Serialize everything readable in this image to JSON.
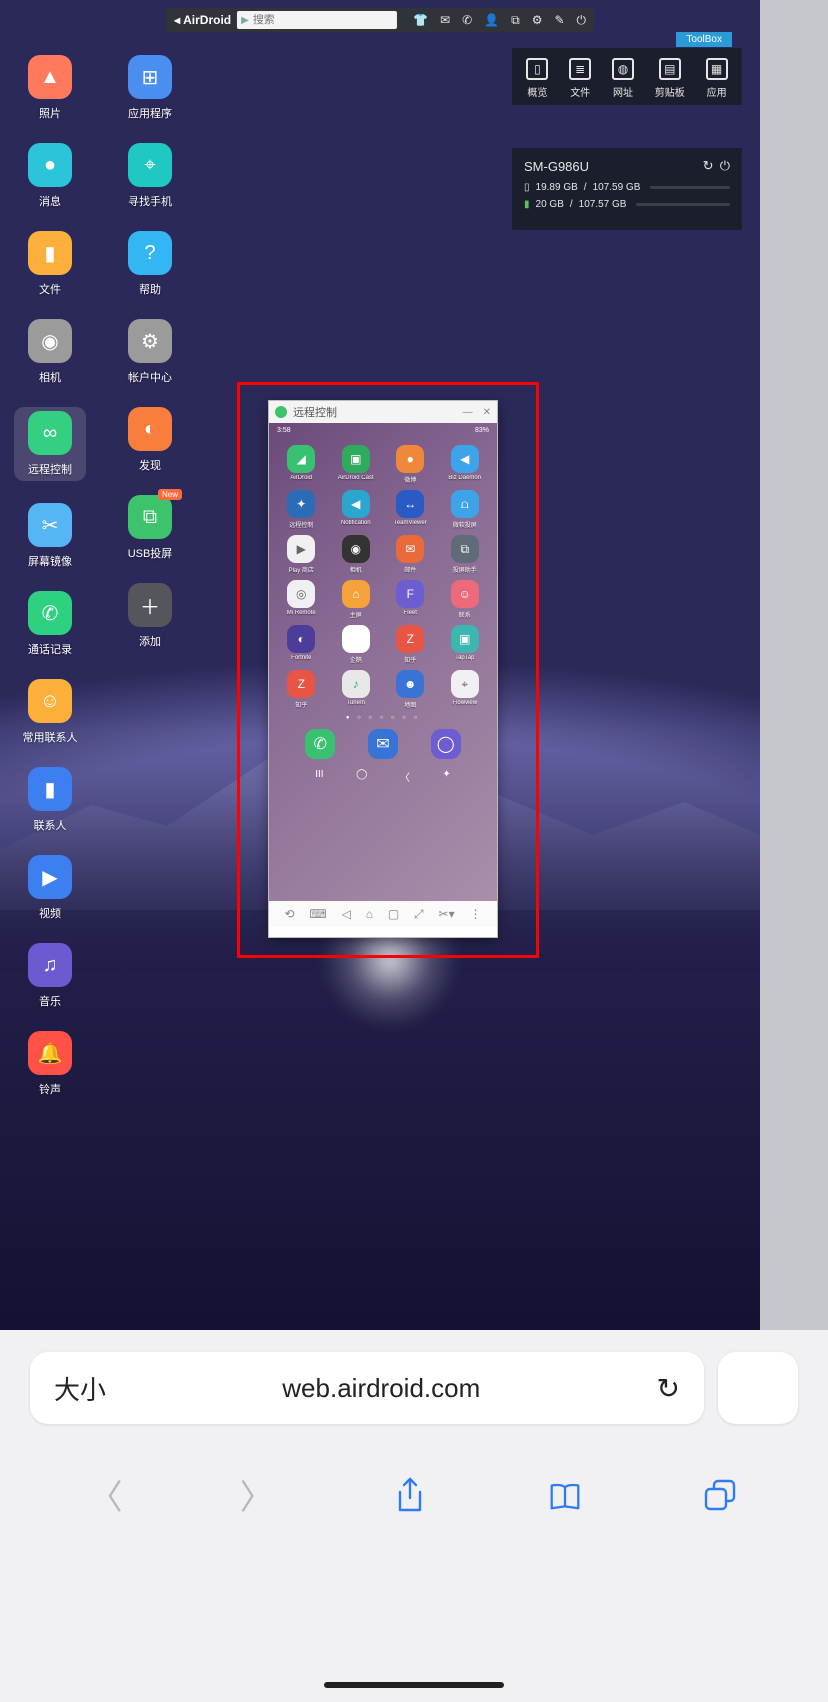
{
  "topbar": {
    "brand": "AirDroid",
    "search_placeholder": "搜索"
  },
  "desktop_icons": {
    "col1": [
      {
        "label": "照片",
        "cls": "c-red",
        "glyph": "▲"
      },
      {
        "label": "消息",
        "cls": "c-teal",
        "glyph": "●"
      },
      {
        "label": "文件",
        "cls": "c-orange",
        "glyph": "▮"
      },
      {
        "label": "相机",
        "cls": "c-gray",
        "glyph": "◉"
      },
      {
        "label": "远程控制",
        "cls": "c-green",
        "glyph": "∞",
        "sel": true
      },
      {
        "label": "屏幕镜像",
        "cls": "c-lblue",
        "glyph": "✂"
      },
      {
        "label": "通话记录",
        "cls": "c-tealg",
        "glyph": "✆"
      },
      {
        "label": "常用联系人",
        "cls": "c-orange",
        "glyph": "☺"
      },
      {
        "label": "联系人",
        "cls": "c-navy",
        "glyph": "▮"
      },
      {
        "label": "视频",
        "cls": "c-navy",
        "glyph": "▶"
      },
      {
        "label": "音乐",
        "cls": "c-purple",
        "glyph": "♫"
      },
      {
        "label": "铃声",
        "cls": "c-red2",
        "glyph": "🔔"
      }
    ],
    "col2": [
      {
        "label": "应用程序",
        "cls": "c-blue",
        "glyph": "⊞"
      },
      {
        "label": "寻找手机",
        "cls": "c-teal2",
        "glyph": "⌖"
      },
      {
        "label": "帮助",
        "cls": "c-cyan",
        "glyph": "?"
      },
      {
        "label": "帐户中心",
        "cls": "c-gray",
        "glyph": "⚙"
      },
      {
        "label": "发现",
        "cls": "c-orange2",
        "glyph": "◐"
      },
      {
        "label": "USB投屏",
        "cls": "c-green2",
        "glyph": "⧉",
        "new": true
      },
      {
        "label": "添加",
        "cls": "c-dark",
        "glyph": "＋"
      }
    ]
  },
  "toolbox": {
    "tab": "ToolBox",
    "items": [
      {
        "label": "概览",
        "glyph": "▯"
      },
      {
        "label": "文件",
        "glyph": "≣"
      },
      {
        "label": "网址",
        "glyph": "◍"
      },
      {
        "label": "剪贴板",
        "glyph": "▤"
      },
      {
        "label": "应用",
        "glyph": "▦"
      }
    ]
  },
  "device": {
    "name": "SM-G986U",
    "storage_used": "19.89 GB",
    "storage_total": "107.59 GB",
    "sd_used": "20 GB",
    "sd_total": "107.57 GB",
    "sep": " / "
  },
  "remote": {
    "title": "远程控制",
    "status_time": "3:58",
    "status_right": "83%",
    "apps": [
      {
        "l": "AirDroid",
        "c": "p-green",
        "g": "◢"
      },
      {
        "l": "AirDroid Cast",
        "c": "p-grn2",
        "g": "▣"
      },
      {
        "l": "微博",
        "c": "p-orange",
        "g": "●"
      },
      {
        "l": "Biz Daemon",
        "c": "p-blue",
        "g": "◀"
      },
      {
        "l": "远程控制",
        "c": "p-blue2",
        "g": "✦"
      },
      {
        "l": "Notification",
        "c": "p-teal",
        "g": "◀"
      },
      {
        "l": "TeamViewer",
        "c": "p-navy",
        "g": "↔"
      },
      {
        "l": "微软投屏",
        "c": "p-blue",
        "g": "⩍"
      },
      {
        "l": "Play 商店",
        "c": "p-white",
        "g": "▶"
      },
      {
        "l": "相机",
        "c": "p-black",
        "g": "◉"
      },
      {
        "l": "邮件",
        "c": "p-ored",
        "g": "✉"
      },
      {
        "l": "投屏助手",
        "c": "p-d",
        "g": "⧉"
      },
      {
        "l": "Mi Remote",
        "c": "p-white",
        "g": "◎"
      },
      {
        "l": "主屏",
        "c": "p-or2",
        "g": "⌂"
      },
      {
        "l": "Fleet",
        "c": "p-purp",
        "g": "F"
      },
      {
        "l": "联系",
        "c": "p-pk",
        "g": "☺"
      },
      {
        "l": "Fortnite",
        "c": "p-pp2",
        "g": "◐"
      },
      {
        "l": "企鹅",
        "c": "p-yel",
        "g": "●"
      },
      {
        "l": "知乎",
        "c": "p-red",
        "g": "Z"
      },
      {
        "l": "TapTap",
        "c": "p-tl2",
        "g": "▣"
      },
      {
        "l": "知乎",
        "c": "p-red",
        "g": "Z"
      },
      {
        "l": "TuneIn",
        "c": "p-mint",
        "g": "♪"
      },
      {
        "l": "地图",
        "c": "p-bl3",
        "g": "☻"
      },
      {
        "l": "Flowview",
        "c": "p-white",
        "g": "⌖"
      }
    ],
    "dock": [
      {
        "c": "p-green",
        "g": "✆"
      },
      {
        "c": "p-bl3",
        "g": "✉"
      },
      {
        "c": "p-purp",
        "g": "◯"
      }
    ]
  },
  "safari": {
    "size_label": "大小",
    "url": "web.airdroid.com"
  }
}
